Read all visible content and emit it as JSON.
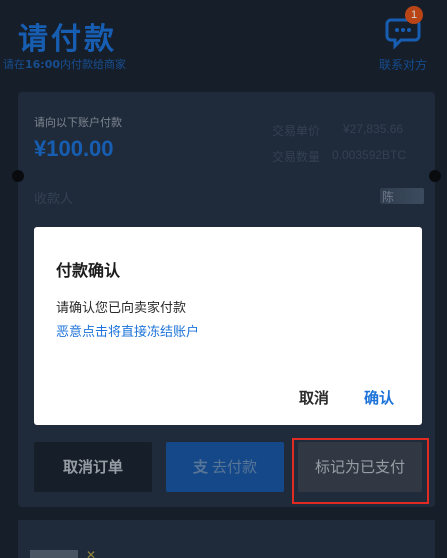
{
  "header": {
    "title": "请付款",
    "subtitle_prefix": "请在",
    "subtitle_time": "16:00",
    "subtitle_suffix": "内付款给商家",
    "contact_label": "联系对方",
    "badge_count": "1"
  },
  "order": {
    "pay_to_label": "请向以下账户付款",
    "amount": "¥100.00",
    "price_label": "交易单价",
    "price_value": "¥27,835.66",
    "qty_label": "交易数量",
    "qty_value": "0.003592BTC",
    "payee_label": "收款人",
    "payee_value_initial": "陈"
  },
  "actions": {
    "cancel_order": "取消订单",
    "go_pay": "去付款",
    "mark_paid": "标记为已支付"
  },
  "dialog": {
    "title": "付款确认",
    "message": "请确认您已向卖家付款",
    "warning": "恶意点击将直接冻结账户",
    "cancel": "取消",
    "confirm": "确认"
  },
  "colors": {
    "accent": "#1d73d9",
    "badge": "#e2551b",
    "highlight": "#e12b22"
  },
  "icons": {
    "chat": "chat-bubble-icon",
    "alipay": "alipay-icon"
  }
}
